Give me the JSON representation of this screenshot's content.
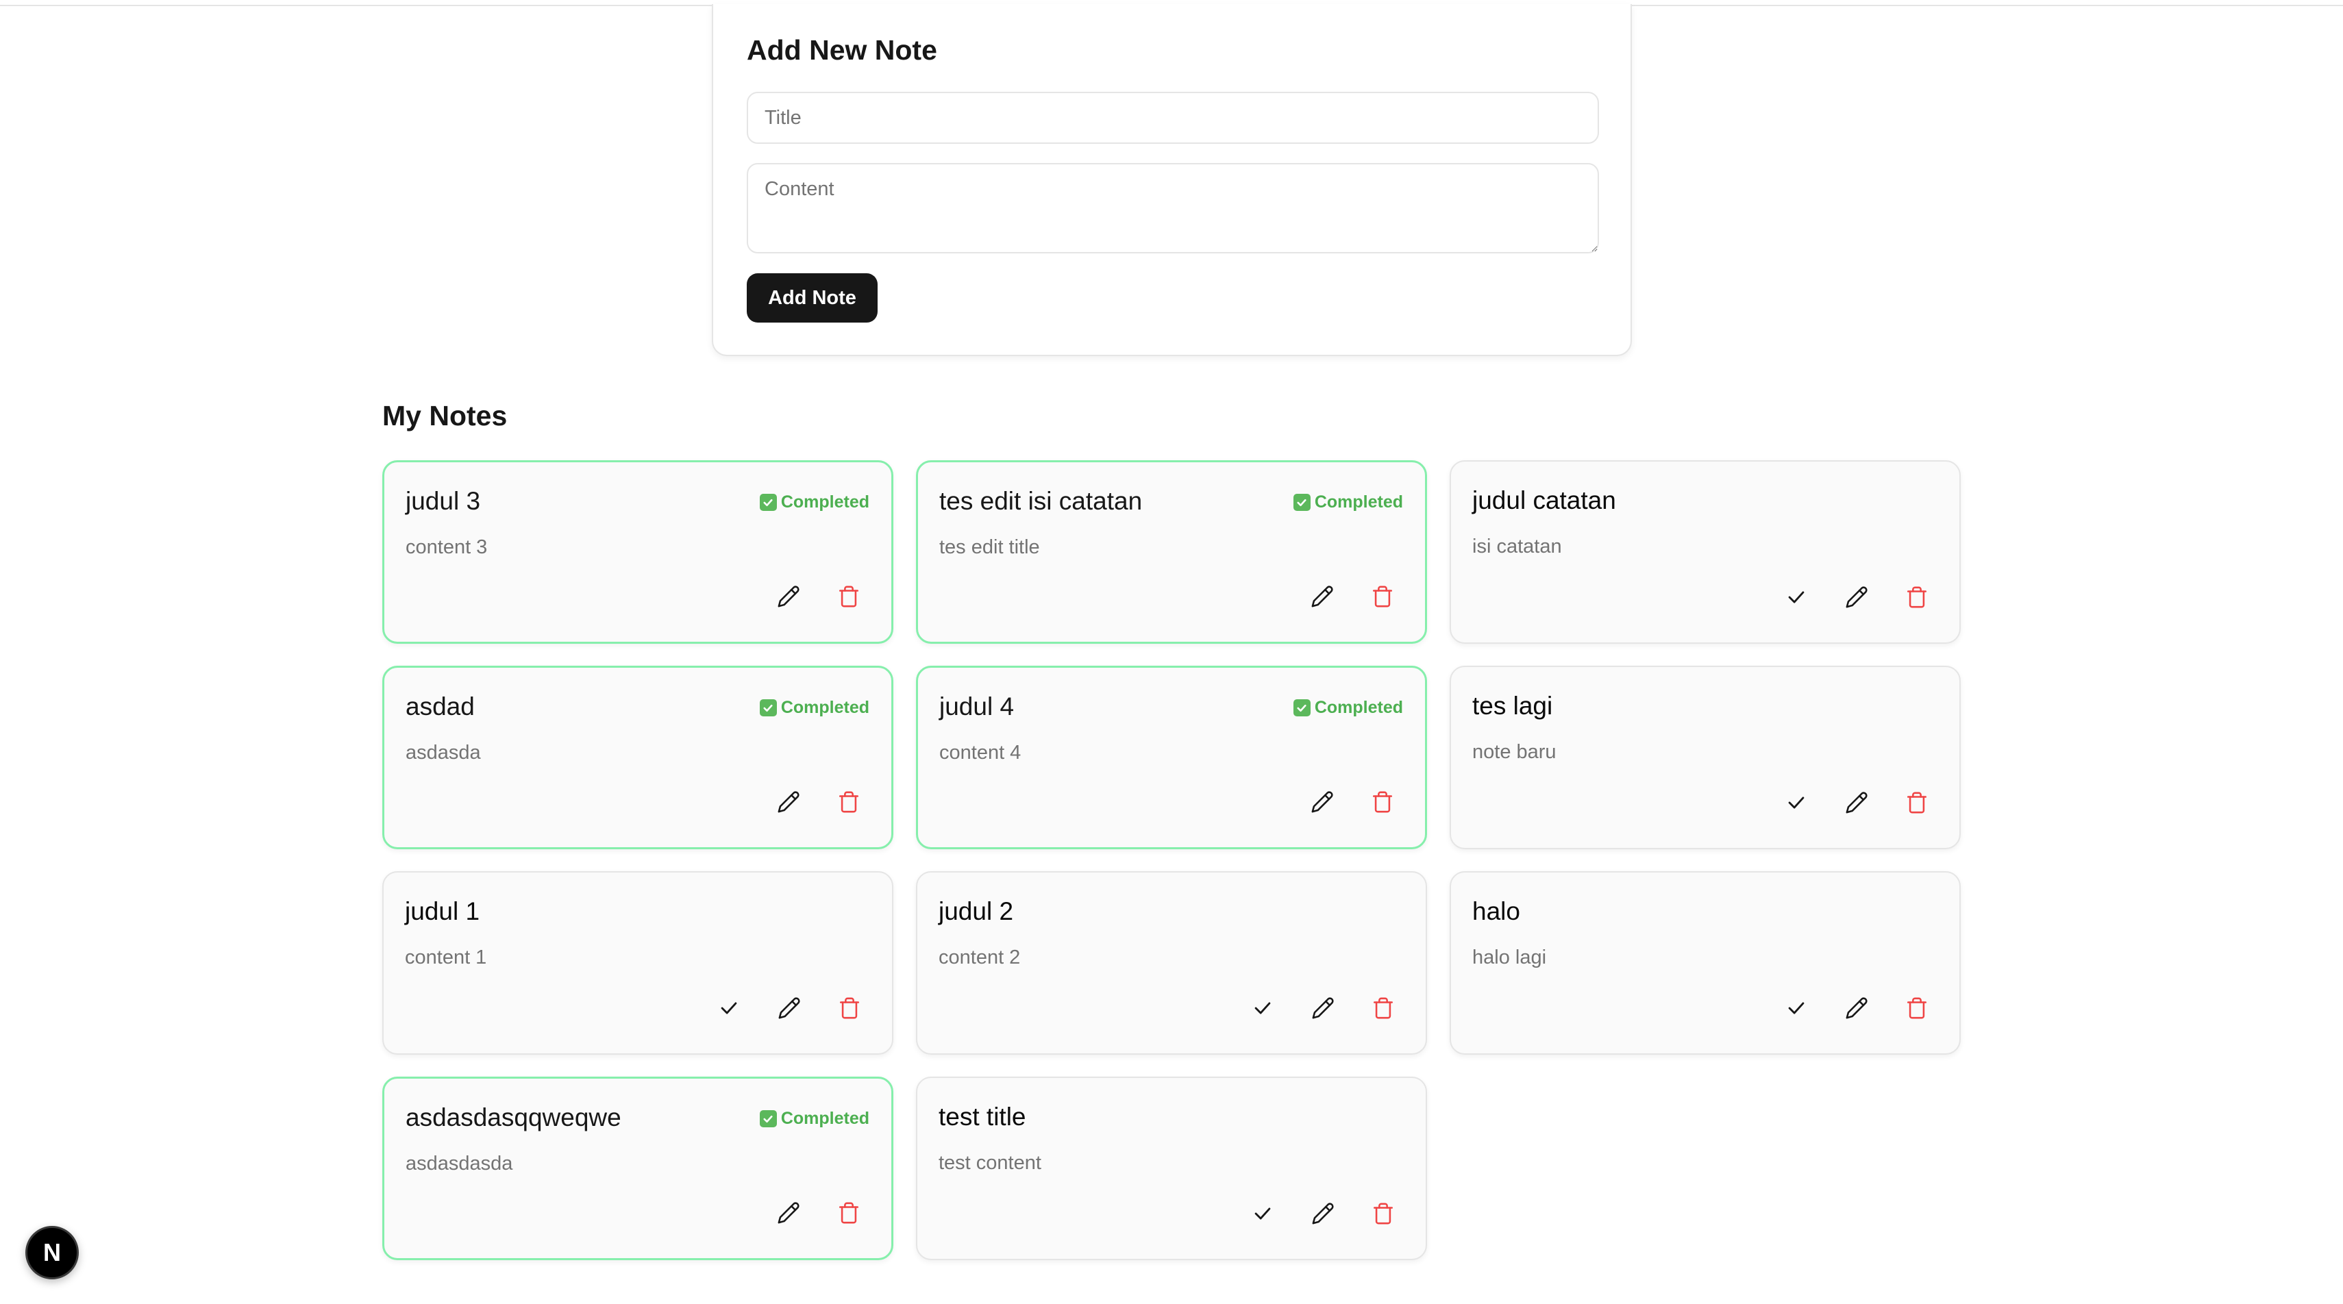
{
  "form": {
    "heading": "Add New Note",
    "title_placeholder": "Title",
    "title_value": "",
    "content_placeholder": "Content",
    "content_value": "",
    "submit_label": "Add Note"
  },
  "notes_section": {
    "heading": "My Notes",
    "completed_label": "Completed",
    "notes": [
      {
        "title": "judul 3",
        "content": "content 3",
        "completed": true
      },
      {
        "title": "tes edit isi catatan",
        "content": "tes edit title",
        "completed": true
      },
      {
        "title": "judul catatan",
        "content": "isi catatan",
        "completed": false
      },
      {
        "title": "asdad",
        "content": "asdasda",
        "completed": true
      },
      {
        "title": "judul 4",
        "content": "content 4",
        "completed": true
      },
      {
        "title": "tes lagi",
        "content": "note baru",
        "completed": false
      },
      {
        "title": "judul 1",
        "content": "content 1",
        "completed": false
      },
      {
        "title": "judul 2",
        "content": "content 2",
        "completed": false
      },
      {
        "title": "halo",
        "content": "halo lagi",
        "completed": false
      },
      {
        "title": "asdasdasqqweqwe",
        "content": "asdasdasda",
        "completed": true
      },
      {
        "title": "test title",
        "content": "test content",
        "completed": false
      }
    ]
  },
  "dev_badge": {
    "letter": "N"
  },
  "colors": {
    "completed_border": "#86efac",
    "completed_text": "#4caf50",
    "delete_icon": "#ef4444",
    "primary_button": "#171717"
  },
  "icons": {
    "complete": "check-icon",
    "edit": "pencil-icon",
    "delete": "trash-icon",
    "completed_badge": "checkbox-checked-icon"
  }
}
